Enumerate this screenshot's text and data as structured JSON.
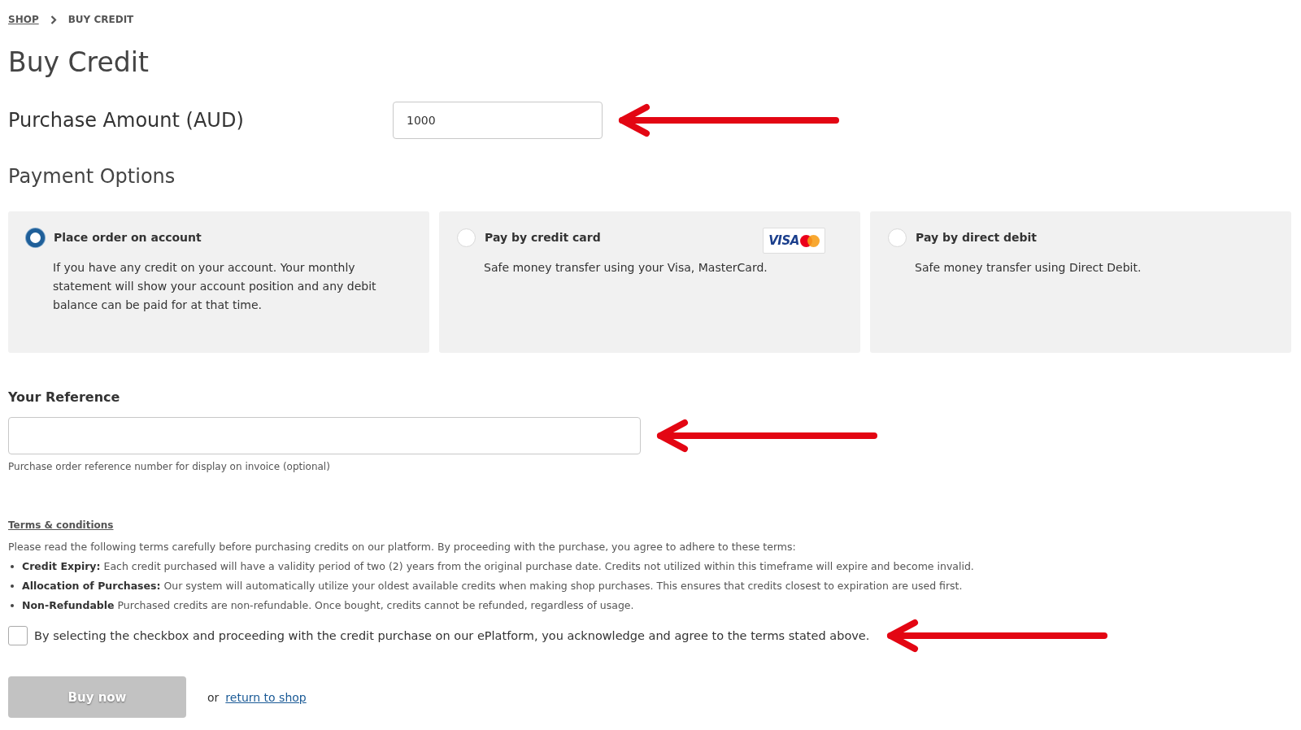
{
  "breadcrumb": [
    {
      "label": "SHOP",
      "link": true
    },
    {
      "label": "BUY CREDIT",
      "link": false
    }
  ],
  "title": "Buy Credit",
  "purchase_amount": {
    "label": "Purchase Amount (AUD)",
    "value": "1000"
  },
  "payment_options": {
    "heading": "Payment Options",
    "options": [
      {
        "title": "Place order on account",
        "description": "If you have any credit on your account. Your monthly statement will show your account position and any debit balance can be paid for at that time.",
        "selected": true
      },
      {
        "title": "Pay by credit card",
        "description": "Safe money transfer using your Visa, MasterCard.",
        "selected": false,
        "logo": {
          "text": "VISA"
        }
      },
      {
        "title": "Pay by direct debit",
        "description": "Safe money transfer using Direct Debit.",
        "selected": false
      }
    ]
  },
  "reference": {
    "label": "Your Reference",
    "hint": "Purchase order reference number for display on invoice (optional)"
  },
  "terms": {
    "heading": "Terms & conditions",
    "intro": "Please read the following terms carefully before purchasing credits on our platform. By proceeding with the purchase, you agree to adhere to these terms:",
    "items": [
      "**Credit Expiry:** Each credit purchased will have a validity period of two (2) years from the original purchase date. Credits not utilized within this timeframe will expire and become invalid.",
      "**Allocation of Purchases:** Our system will automatically utilize your oldest available credits when making shop purchases. This ensures that credits closest to expiration are used first.",
      "**Non-Refundable** Purchased credits are non-refundable. Once bought, credits cannot be refunded, regardless of usage."
    ],
    "agreement": {
      "text": "By selecting the checkbox and proceeding with the credit purchase on our ePlatform, you acknowledge and agree to the terms stated above.",
      "checked": false
    }
  },
  "buy_button": {
    "label": "Buy now",
    "disabled": true
  },
  "return": {
    "or": "or",
    "link": "return to shop"
  }
}
